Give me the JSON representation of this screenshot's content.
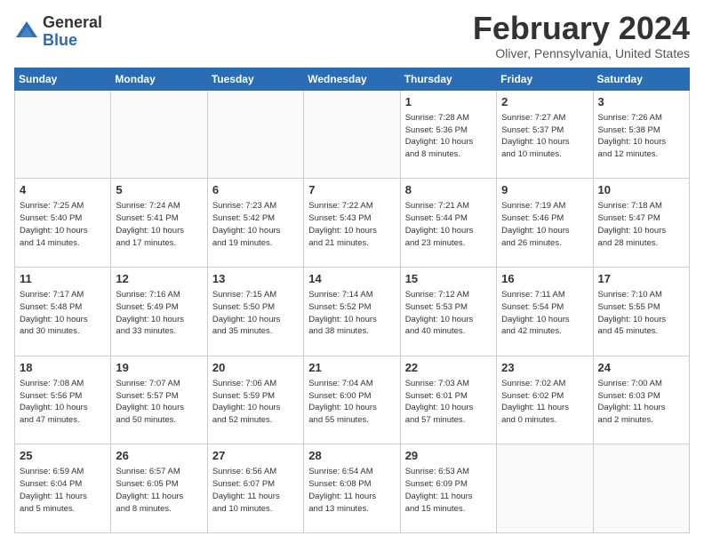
{
  "header": {
    "logo_general": "General",
    "logo_blue": "Blue",
    "month_title": "February 2024",
    "location": "Oliver, Pennsylvania, United States"
  },
  "days_of_week": [
    "Sunday",
    "Monday",
    "Tuesday",
    "Wednesday",
    "Thursday",
    "Friday",
    "Saturday"
  ],
  "weeks": [
    [
      {
        "day": "",
        "info": ""
      },
      {
        "day": "",
        "info": ""
      },
      {
        "day": "",
        "info": ""
      },
      {
        "day": "",
        "info": ""
      },
      {
        "day": "1",
        "info": "Sunrise: 7:28 AM\nSunset: 5:36 PM\nDaylight: 10 hours\nand 8 minutes."
      },
      {
        "day": "2",
        "info": "Sunrise: 7:27 AM\nSunset: 5:37 PM\nDaylight: 10 hours\nand 10 minutes."
      },
      {
        "day": "3",
        "info": "Sunrise: 7:26 AM\nSunset: 5:38 PM\nDaylight: 10 hours\nand 12 minutes."
      }
    ],
    [
      {
        "day": "4",
        "info": "Sunrise: 7:25 AM\nSunset: 5:40 PM\nDaylight: 10 hours\nand 14 minutes."
      },
      {
        "day": "5",
        "info": "Sunrise: 7:24 AM\nSunset: 5:41 PM\nDaylight: 10 hours\nand 17 minutes."
      },
      {
        "day": "6",
        "info": "Sunrise: 7:23 AM\nSunset: 5:42 PM\nDaylight: 10 hours\nand 19 minutes."
      },
      {
        "day": "7",
        "info": "Sunrise: 7:22 AM\nSunset: 5:43 PM\nDaylight: 10 hours\nand 21 minutes."
      },
      {
        "day": "8",
        "info": "Sunrise: 7:21 AM\nSunset: 5:44 PM\nDaylight: 10 hours\nand 23 minutes."
      },
      {
        "day": "9",
        "info": "Sunrise: 7:19 AM\nSunset: 5:46 PM\nDaylight: 10 hours\nand 26 minutes."
      },
      {
        "day": "10",
        "info": "Sunrise: 7:18 AM\nSunset: 5:47 PM\nDaylight: 10 hours\nand 28 minutes."
      }
    ],
    [
      {
        "day": "11",
        "info": "Sunrise: 7:17 AM\nSunset: 5:48 PM\nDaylight: 10 hours\nand 30 minutes."
      },
      {
        "day": "12",
        "info": "Sunrise: 7:16 AM\nSunset: 5:49 PM\nDaylight: 10 hours\nand 33 minutes."
      },
      {
        "day": "13",
        "info": "Sunrise: 7:15 AM\nSunset: 5:50 PM\nDaylight: 10 hours\nand 35 minutes."
      },
      {
        "day": "14",
        "info": "Sunrise: 7:14 AM\nSunset: 5:52 PM\nDaylight: 10 hours\nand 38 minutes."
      },
      {
        "day": "15",
        "info": "Sunrise: 7:12 AM\nSunset: 5:53 PM\nDaylight: 10 hours\nand 40 minutes."
      },
      {
        "day": "16",
        "info": "Sunrise: 7:11 AM\nSunset: 5:54 PM\nDaylight: 10 hours\nand 42 minutes."
      },
      {
        "day": "17",
        "info": "Sunrise: 7:10 AM\nSunset: 5:55 PM\nDaylight: 10 hours\nand 45 minutes."
      }
    ],
    [
      {
        "day": "18",
        "info": "Sunrise: 7:08 AM\nSunset: 5:56 PM\nDaylight: 10 hours\nand 47 minutes."
      },
      {
        "day": "19",
        "info": "Sunrise: 7:07 AM\nSunset: 5:57 PM\nDaylight: 10 hours\nand 50 minutes."
      },
      {
        "day": "20",
        "info": "Sunrise: 7:06 AM\nSunset: 5:59 PM\nDaylight: 10 hours\nand 52 minutes."
      },
      {
        "day": "21",
        "info": "Sunrise: 7:04 AM\nSunset: 6:00 PM\nDaylight: 10 hours\nand 55 minutes."
      },
      {
        "day": "22",
        "info": "Sunrise: 7:03 AM\nSunset: 6:01 PM\nDaylight: 10 hours\nand 57 minutes."
      },
      {
        "day": "23",
        "info": "Sunrise: 7:02 AM\nSunset: 6:02 PM\nDaylight: 11 hours\nand 0 minutes."
      },
      {
        "day": "24",
        "info": "Sunrise: 7:00 AM\nSunset: 6:03 PM\nDaylight: 11 hours\nand 2 minutes."
      }
    ],
    [
      {
        "day": "25",
        "info": "Sunrise: 6:59 AM\nSunset: 6:04 PM\nDaylight: 11 hours\nand 5 minutes."
      },
      {
        "day": "26",
        "info": "Sunrise: 6:57 AM\nSunset: 6:05 PM\nDaylight: 11 hours\nand 8 minutes."
      },
      {
        "day": "27",
        "info": "Sunrise: 6:56 AM\nSunset: 6:07 PM\nDaylight: 11 hours\nand 10 minutes."
      },
      {
        "day": "28",
        "info": "Sunrise: 6:54 AM\nSunset: 6:08 PM\nDaylight: 11 hours\nand 13 minutes."
      },
      {
        "day": "29",
        "info": "Sunrise: 6:53 AM\nSunset: 6:09 PM\nDaylight: 11 hours\nand 15 minutes."
      },
      {
        "day": "",
        "info": ""
      },
      {
        "day": "",
        "info": ""
      }
    ]
  ]
}
